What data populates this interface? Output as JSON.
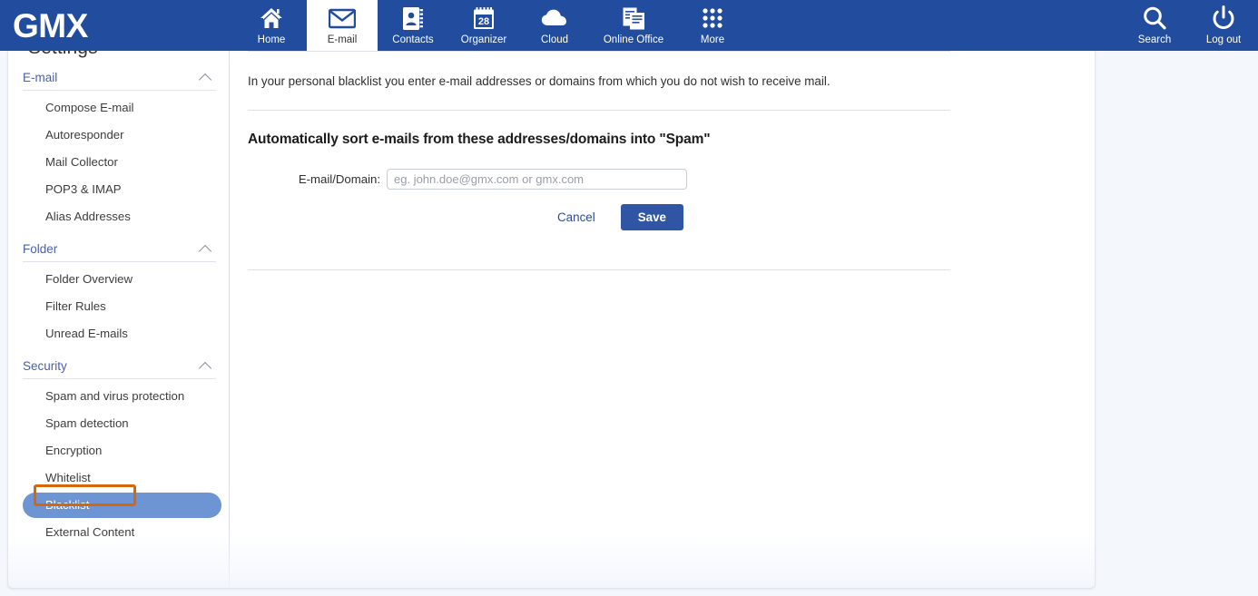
{
  "header": {
    "logo": "GMX",
    "nav_items": [
      {
        "label": "Home",
        "icon": "home-icon",
        "active": false
      },
      {
        "label": "E-mail",
        "icon": "envelope-icon",
        "active": true
      },
      {
        "label": "Contacts",
        "icon": "contacts-book-icon",
        "active": false
      },
      {
        "label": "Organizer",
        "icon": "calendar-icon",
        "active": false
      },
      {
        "label": "Cloud",
        "icon": "cloud-icon",
        "active": false
      },
      {
        "label": "Online Office",
        "icon": "documents-icon",
        "active": false
      },
      {
        "label": "More",
        "icon": "grid-dots-icon",
        "active": false
      }
    ],
    "right_items": [
      {
        "label": "Search",
        "icon": "search-icon"
      },
      {
        "label": "Log out",
        "icon": "power-icon"
      }
    ],
    "background_color": "#224d9e"
  },
  "sidebar": {
    "title": "Settings",
    "sections": [
      {
        "title": "E-mail",
        "expanded": true,
        "items": [
          {
            "label": "Compose E-mail",
            "selected": false
          },
          {
            "label": "Autoresponder",
            "selected": false
          },
          {
            "label": "Mail Collector",
            "selected": false
          },
          {
            "label": "POP3 & IMAP",
            "selected": false
          },
          {
            "label": "Alias Addresses",
            "selected": false
          }
        ]
      },
      {
        "title": "Folder",
        "expanded": true,
        "items": [
          {
            "label": "Folder Overview",
            "selected": false
          },
          {
            "label": "Filter Rules",
            "selected": false
          },
          {
            "label": "Unread E-mails",
            "selected": false
          }
        ]
      },
      {
        "title": "Security",
        "expanded": true,
        "items": [
          {
            "label": "Spam and virus protection",
            "selected": false
          },
          {
            "label": "Spam detection",
            "selected": false
          },
          {
            "label": "Encryption",
            "selected": false
          },
          {
            "label": "Whitelist",
            "selected": false
          },
          {
            "label": "Blacklist",
            "selected": true
          },
          {
            "label": "External Content",
            "selected": false
          }
        ]
      }
    ],
    "selected_color": "#6d95d4",
    "section_title_color": "#4a5fa8",
    "annotation_color": "#d9650a"
  },
  "main": {
    "intro_text": "In your personal blacklist you enter e-mail addresses or domains from which you do not wish to receive mail.",
    "section_title": "Automatically sort e-mails from these addresses/domains into \"Spam\"",
    "form": {
      "field_label": "E-mail/Domain:",
      "input_value": "",
      "input_placeholder": "eg. john.doe@gmx.com or gmx.com"
    },
    "cancel_label": "Cancel",
    "save_label": "Save",
    "save_color": "#2f55a4",
    "link_color": "#2b4a9b"
  }
}
